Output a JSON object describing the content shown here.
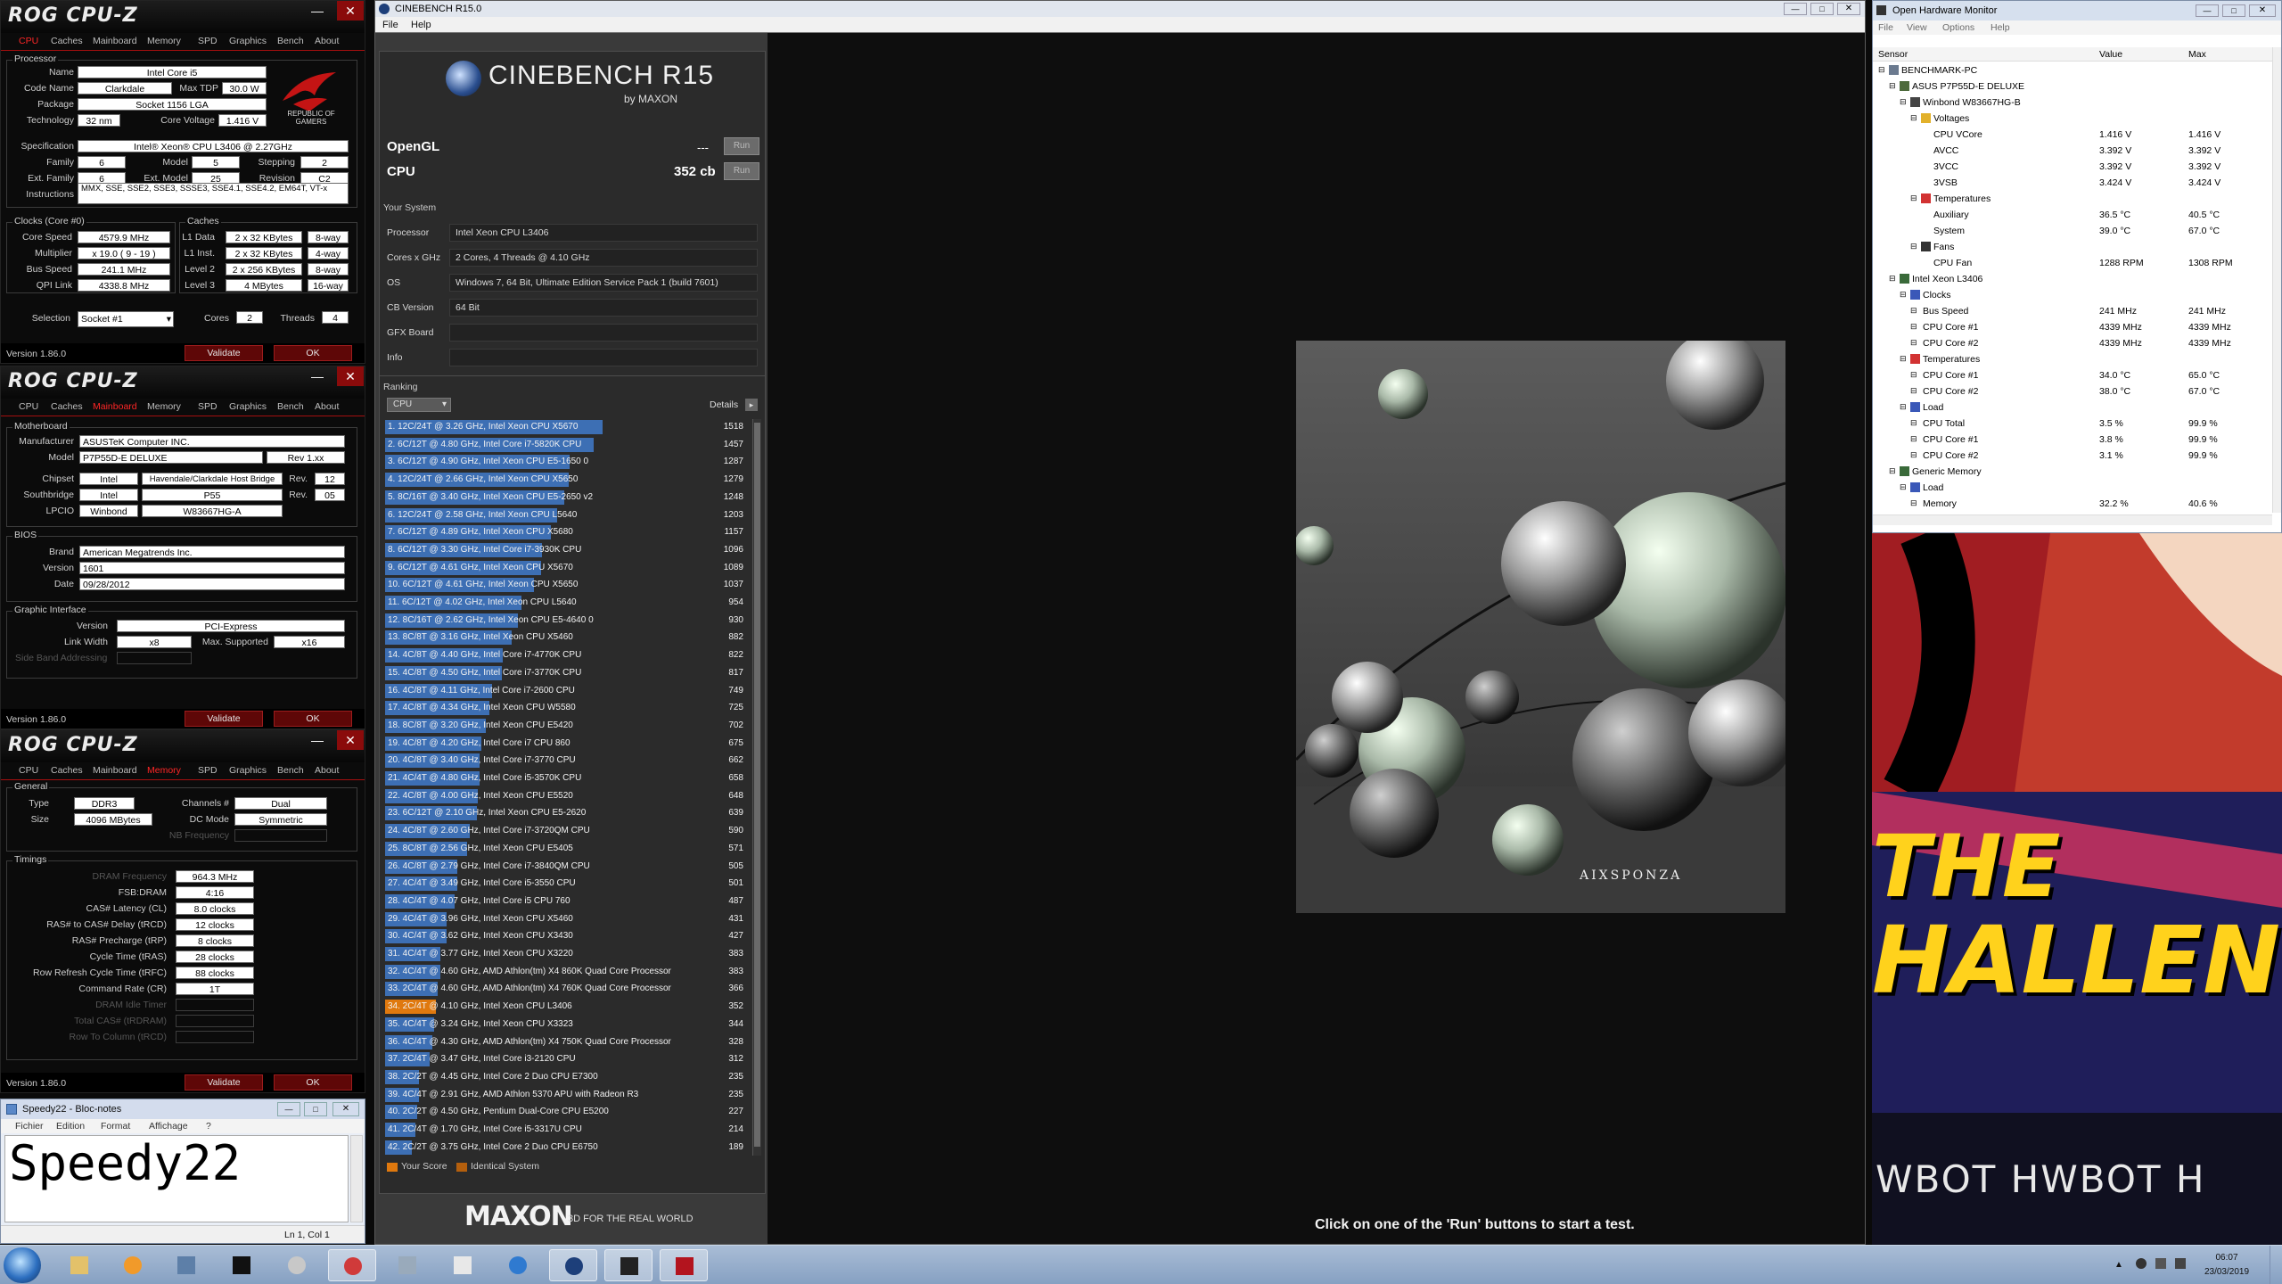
{
  "cpuz": {
    "logo": "ROG CPU-Z",
    "tabs": [
      "CPU",
      "Caches",
      "Mainboard",
      "Memory",
      "SPD",
      "Graphics",
      "Bench",
      "About"
    ],
    "version": "Version 1.86.0",
    "validate": "Validate",
    "ok": "OK",
    "cpu": {
      "processor_legend": "Processor",
      "name_lbl": "Name",
      "name": "Intel Core i5",
      "codename_lbl": "Code Name",
      "codename": "Clarkdale",
      "maxtdp_lbl": "Max TDP",
      "maxtdp": "30.0 W",
      "package_lbl": "Package",
      "package": "Socket 1156 LGA",
      "tech_lbl": "Technology",
      "tech": "32 nm",
      "corev_lbl": "Core Voltage",
      "corev": "1.416 V",
      "spec_lbl": "Specification",
      "spec": "Intel® Xeon® CPU        L3406  @ 2.27GHz",
      "family_lbl": "Family",
      "family": "6",
      "model_lbl": "Model",
      "model": "5",
      "stepping_lbl": "Stepping",
      "stepping": "2",
      "extfamily_lbl": "Ext. Family",
      "extfamily": "6",
      "extmodel_lbl": "Ext. Model",
      "extmodel": "25",
      "revision_lbl": "Revision",
      "revision": "C2",
      "instr_lbl": "Instructions",
      "instr": "MMX, SSE, SSE2, SSE3, SSSE3, SSE4.1, SSE4.2, EM64T, VT-x",
      "republic": "REPUBLIC OF GAMERS",
      "clocks_legend": "Clocks (Core #0)",
      "corespeed_lbl": "Core Speed",
      "corespeed": "4579.9 MHz",
      "multiplier_lbl": "Multiplier",
      "multiplier": "x 19.0 ( 9 - 19 )",
      "busspeed_lbl": "Bus Speed",
      "busspeed": "241.1 MHz",
      "qpi_lbl": "QPI Link",
      "qpi": "4338.8 MHz",
      "caches_legend": "Caches",
      "l1d_lbl": "L1 Data",
      "l1d": "2 x 32 KBytes",
      "l1d_way": "8-way",
      "l1i_lbl": "L1 Inst.",
      "l1i": "2 x 32 KBytes",
      "l1i_way": "4-way",
      "l2_lbl": "Level 2",
      "l2": "2 x 256 KBytes",
      "l2_way": "8-way",
      "l3_lbl": "Level 3",
      "l3": "4 MBytes",
      "l3_way": "16-way",
      "selection_lbl": "Selection",
      "selection": "Socket #1",
      "cores_lbl": "Cores",
      "cores": "2",
      "threads_lbl": "Threads",
      "threads": "4"
    },
    "mb": {
      "mb_legend": "Motherboard",
      "manufacturer_lbl": "Manufacturer",
      "manufacturer": "ASUSTeK Computer INC.",
      "model_lbl": "Model",
      "model": "P7P55D-E DELUXE",
      "model_rev": "Rev 1.xx",
      "chipset_lbl": "Chipset",
      "chipset_vendor": "Intel",
      "chipset": "Havendale/Clarkdale Host Bridge",
      "rev_lbl": "Rev.",
      "chipset_rev": "12",
      "south_lbl": "Southbridge",
      "south_vendor": "Intel",
      "south": "P55",
      "south_rev": "05",
      "lpcio_lbl": "LPCIO",
      "lpcio_vendor": "Winbond",
      "lpcio": "W83667HG-A",
      "bios_legend": "BIOS",
      "brand_lbl": "Brand",
      "brand": "American Megatrends Inc.",
      "version_lbl": "Version",
      "version": "1601",
      "date_lbl": "Date",
      "date": "09/28/2012",
      "gi_legend": "Graphic Interface",
      "gi_version_lbl": "Version",
      "gi_version": "PCI-Express",
      "linkwidth_lbl": "Link Width",
      "linkwidth": "x8",
      "maxsup_lbl": "Max. Supported",
      "maxsup": "x16",
      "sideband_lbl": "Side Band Addressing"
    },
    "mem": {
      "general_legend": "General",
      "type_lbl": "Type",
      "type": "DDR3",
      "channels_lbl": "Channels #",
      "channels": "Dual",
      "size_lbl": "Size",
      "size": "4096 MBytes",
      "dcmode_lbl": "DC Mode",
      "dcmode": "Symmetric",
      "nbfreq_lbl": "NB Frequency",
      "timings_legend": "Timings",
      "dram_lbl": "DRAM Frequency",
      "dram": "964.3 MHz",
      "fsb_lbl": "FSB:DRAM",
      "fsb": "4:16",
      "cl_lbl": "CAS# Latency (CL)",
      "cl": "8.0 clocks",
      "trcd_lbl": "RAS# to CAS# Delay (tRCD)",
      "trcd": "12 clocks",
      "trp_lbl": "RAS# Precharge (tRP)",
      "trp": "8 clocks",
      "tras_lbl": "Cycle Time (tRAS)",
      "tras": "28 clocks",
      "trfc_lbl": "Row Refresh Cycle Time (tRFC)",
      "trfc": "88 clocks",
      "cr_lbl": "Command Rate (CR)",
      "cr": "1T",
      "idle_lbl": "DRAM Idle Timer",
      "tcas_lbl": "Total CAS# (tRDRAM)",
      "rtc_lbl": "Row To Column (tRCD)"
    }
  },
  "notepad": {
    "title": "Speedy22 - Bloc-notes",
    "menu": [
      "Fichier",
      "Edition",
      "Format",
      "Affichage",
      "?"
    ],
    "text": "Speedy22",
    "status": "Ln 1, Col 1"
  },
  "cinebench": {
    "title": "CINEBENCH R15.0",
    "menu": [
      "File",
      "Help"
    ],
    "logo_main": "CINEBENCH R15",
    "logo_sub": "by MAXON",
    "opengl_lbl": "OpenGL",
    "opengl_val": "---",
    "cpu_lbl": "CPU",
    "cpu_val": "352 cb",
    "run": "Run",
    "yoursystem": "Your System",
    "system": [
      {
        "k": "Processor",
        "v": "Intel Xeon CPU L3406"
      },
      {
        "k": "Cores x GHz",
        "v": "2 Cores, 4 Threads @ 4.10 GHz"
      },
      {
        "k": "OS",
        "v": "Windows 7, 64 Bit, Ultimate Edition Service Pack 1 (build 7601)"
      },
      {
        "k": "CB Version",
        "v": "64 Bit"
      },
      {
        "k": "GFX Board",
        "v": ""
      },
      {
        "k": "Info",
        "v": ""
      }
    ],
    "ranking": "Ranking",
    "ranking_select": "CPU",
    "details": "Details",
    "legend_your": "Your Score",
    "legend_ident": "Identical System",
    "maxon": "MAXON",
    "tagline": "3D FOR THE REAL WORLD",
    "render_credit": "AIXSPONZA",
    "status": "Click on one of the 'Run' buttons to start a test.",
    "accent": "#e0790e",
    "bar_color": "#3d6fb4"
  },
  "ranking": [
    {
      "label": "1. 12C/24T @ 3.26 GHz, Intel Xeon CPU X5670",
      "score": 1518
    },
    {
      "label": "2. 6C/12T @ 4.80 GHz, Intel Core i7-5820K CPU",
      "score": 1457
    },
    {
      "label": "3. 6C/12T @ 4.90 GHz, Intel Xeon CPU E5-1650 0",
      "score": 1287
    },
    {
      "label": "4. 12C/24T @ 2.66 GHz, Intel Xeon CPU X5650",
      "score": 1279
    },
    {
      "label": "5. 8C/16T @ 3.40 GHz, Intel Xeon CPU E5-2650 v2",
      "score": 1248
    },
    {
      "label": "6. 12C/24T @ 2.58 GHz, Intel Xeon CPU L5640",
      "score": 1203
    },
    {
      "label": "7. 6C/12T @ 4.89 GHz, Intel Xeon CPU X5680",
      "score": 1157
    },
    {
      "label": "8. 6C/12T @ 3.30 GHz, Intel Core i7-3930K CPU",
      "score": 1096
    },
    {
      "label": "9. 6C/12T @ 4.61 GHz, Intel Xeon CPU X5670",
      "score": 1089
    },
    {
      "label": "10. 6C/12T @ 4.61 GHz, Intel Xeon CPU X5650",
      "score": 1037
    },
    {
      "label": "11. 6C/12T @ 4.02 GHz, Intel Xeon CPU L5640",
      "score": 954
    },
    {
      "label": "12. 8C/16T @ 2.62 GHz, Intel Xeon CPU E5-4640 0",
      "score": 930
    },
    {
      "label": "13. 8C/8T @ 3.16 GHz, Intel Xeon CPU X5460",
      "score": 882
    },
    {
      "label": "14. 4C/8T @ 4.40 GHz, Intel Core i7-4770K CPU",
      "score": 822
    },
    {
      "label": "15. 4C/8T @ 4.50 GHz, Intel Core i7-3770K CPU",
      "score": 817
    },
    {
      "label": "16. 4C/8T @ 4.11 GHz, Intel Core i7-2600 CPU",
      "score": 749
    },
    {
      "label": "17. 4C/8T @ 4.34 GHz, Intel Xeon CPU W5580",
      "score": 725
    },
    {
      "label": "18. 8C/8T @ 3.20 GHz, Intel Xeon CPU E5420",
      "score": 702
    },
    {
      "label": "19. 4C/8T @ 4.20 GHz, Intel Core i7 CPU 860",
      "score": 675
    },
    {
      "label": "20. 4C/8T @ 3.40 GHz, Intel Core i7-3770 CPU",
      "score": 662
    },
    {
      "label": "21. 4C/4T @ 4.80 GHz, Intel Core i5-3570K CPU",
      "score": 658
    },
    {
      "label": "22. 4C/8T @ 4.00 GHz, Intel Xeon CPU E5520",
      "score": 648
    },
    {
      "label": "23. 6C/12T @ 2.10 GHz, Intel Xeon CPU E5-2620",
      "score": 639
    },
    {
      "label": "24. 4C/8T @ 2.60 GHz, Intel Core i7-3720QM CPU",
      "score": 590
    },
    {
      "label": "25. 8C/8T @ 2.56 GHz, Intel Xeon CPU E5405",
      "score": 571
    },
    {
      "label": "26. 4C/8T @ 2.79 GHz, Intel Core i7-3840QM CPU",
      "score": 505
    },
    {
      "label": "27. 4C/4T @ 3.49 GHz, Intel Core i5-3550 CPU",
      "score": 501
    },
    {
      "label": "28. 4C/4T @ 4.07 GHz, Intel Core i5 CPU 760",
      "score": 487
    },
    {
      "label": "29. 4C/4T @ 3.96 GHz, Intel Xeon CPU X5460",
      "score": 431
    },
    {
      "label": "30. 4C/4T @ 3.62 GHz, Intel Xeon CPU X3430",
      "score": 427
    },
    {
      "label": "31. 4C/4T @ 3.77 GHz, Intel Xeon CPU X3220",
      "score": 383
    },
    {
      "label": "32. 4C/4T @ 4.60 GHz, AMD Athlon(tm) X4 860K Quad Core Processor",
      "score": 383
    },
    {
      "label": "33. 2C/4T @ 4.60 GHz, AMD Athlon(tm) X4 760K Quad Core Processor",
      "score": 366
    },
    {
      "label": "34. 2C/4T @ 4.10 GHz, Intel Xeon CPU L3406",
      "score": 352,
      "mine": true
    },
    {
      "label": "35. 4C/4T @ 3.24 GHz, Intel Xeon CPU X3323",
      "score": 344
    },
    {
      "label": "36. 4C/4T @ 4.30 GHz, AMD Athlon(tm) X4 750K Quad Core Processor",
      "score": 328
    },
    {
      "label": "37. 2C/4T @ 3.47 GHz, Intel Core i3-2120 CPU",
      "score": 312
    },
    {
      "label": "38. 2C/2T @ 4.45 GHz, Intel Core 2 Duo CPU E7300",
      "score": 235
    },
    {
      "label": "39. 4C/4T @ 2.91 GHz, AMD Athlon 5370 APU with Radeon R3",
      "score": 235
    },
    {
      "label": "40. 2C/2T @ 4.50 GHz, Pentium Dual-Core CPU E5200",
      "score": 227
    },
    {
      "label": "41. 2C/4T @ 1.70 GHz, Intel Core i5-3317U CPU",
      "score": 214
    },
    {
      "label": "42. 2C/2T @ 3.75 GHz, Intel Core 2 Duo CPU E6750",
      "score": 189
    }
  ],
  "ohm": {
    "title": "Open Hardware Monitor",
    "menu": [
      "File",
      "View",
      "Options",
      "Help"
    ],
    "headers": [
      "Sensor",
      "Value",
      "Max"
    ],
    "rows": [
      {
        "name": "BENCHMARK-PC",
        "value": "",
        "max": "",
        "level": 0,
        "icon": "computer-icon"
      },
      {
        "name": "ASUS P7P55D-E DELUXE",
        "value": "",
        "max": "",
        "level": 1,
        "icon": "motherboard-icon"
      },
      {
        "name": "Winbond W83667HG-B",
        "value": "",
        "max": "",
        "level": 2,
        "icon": "chip-icon"
      },
      {
        "name": "Voltages",
        "value": "",
        "max": "",
        "level": 3,
        "icon": "lightning-icon"
      },
      {
        "name": "CPU VCore",
        "value": "1.416 V",
        "max": "1.416 V",
        "level": 4,
        "icon": ""
      },
      {
        "name": "AVCC",
        "value": "3.392 V",
        "max": "3.392 V",
        "level": 4,
        "icon": ""
      },
      {
        "name": "3VCC",
        "value": "3.392 V",
        "max": "3.392 V",
        "level": 4,
        "icon": ""
      },
      {
        "name": "3VSB",
        "value": "3.424 V",
        "max": "3.424 V",
        "level": 4,
        "icon": ""
      },
      {
        "name": "Temperatures",
        "value": "",
        "max": "",
        "level": 3,
        "icon": "thermometer-icon"
      },
      {
        "name": "Auxiliary",
        "value": "36.5 °C",
        "max": "40.5 °C",
        "level": 4,
        "icon": ""
      },
      {
        "name": "System",
        "value": "39.0 °C",
        "max": "67.0 °C",
        "level": 4,
        "icon": ""
      },
      {
        "name": "Fans",
        "value": "",
        "max": "",
        "level": 3,
        "icon": "fan-icon"
      },
      {
        "name": "CPU Fan",
        "value": "1288 RPM",
        "max": "1308 RPM",
        "level": 4,
        "icon": ""
      },
      {
        "name": "Intel Xeon L3406",
        "value": "",
        "max": "",
        "level": 1,
        "icon": "cpu-icon"
      },
      {
        "name": "Clocks",
        "value": "",
        "max": "",
        "level": 2,
        "icon": "clock-icon"
      },
      {
        "name": "Bus Speed",
        "value": "241 MHz",
        "max": "241 MHz",
        "level": 3,
        "icon": ""
      },
      {
        "name": "CPU Core #1",
        "value": "4339 MHz",
        "max": "4339 MHz",
        "level": 3,
        "icon": ""
      },
      {
        "name": "CPU Core #2",
        "value": "4339 MHz",
        "max": "4339 MHz",
        "level": 3,
        "icon": ""
      },
      {
        "name": "Temperatures",
        "value": "",
        "max": "",
        "level": 2,
        "icon": "thermometer-icon"
      },
      {
        "name": "CPU Core #1",
        "value": "34.0 °C",
        "max": "65.0 °C",
        "level": 3,
        "icon": ""
      },
      {
        "name": "CPU Core #2",
        "value": "38.0 °C",
        "max": "67.0 °C",
        "level": 3,
        "icon": ""
      },
      {
        "name": "Load",
        "value": "",
        "max": "",
        "level": 2,
        "icon": "load-icon"
      },
      {
        "name": "CPU Total",
        "value": "3.5 %",
        "max": "99.9 %",
        "level": 3,
        "icon": ""
      },
      {
        "name": "CPU Core #1",
        "value": "3.8 %",
        "max": "99.9 %",
        "level": 3,
        "icon": ""
      },
      {
        "name": "CPU Core #2",
        "value": "3.1 %",
        "max": "99.9 %",
        "level": 3,
        "icon": ""
      },
      {
        "name": "Generic Memory",
        "value": "",
        "max": "",
        "level": 1,
        "icon": "memory-icon"
      },
      {
        "name": "Load",
        "value": "",
        "max": "",
        "level": 2,
        "icon": "load-icon"
      },
      {
        "name": "Memory",
        "value": "32.2 %",
        "max": "40.6 %",
        "level": 3,
        "icon": ""
      }
    ]
  },
  "video": {
    "line1": "THE",
    "line2": "HALLENG",
    "banner": "WBOT HWBOT H"
  },
  "taskbar": {
    "time": "06:07",
    "date": "23/03/2019"
  }
}
